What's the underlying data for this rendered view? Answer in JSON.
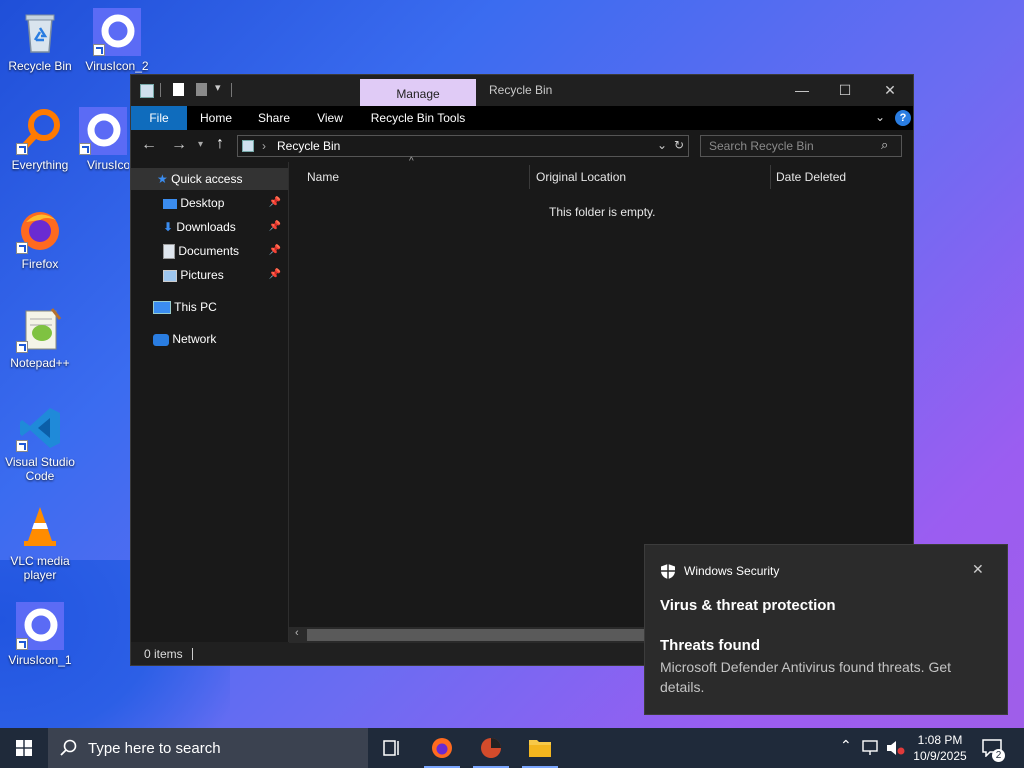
{
  "desktop": {
    "icons": [
      {
        "label": "Recycle Bin",
        "icon": "recycle-bin-icon"
      },
      {
        "label": "VirusIcon_2",
        "icon": "virus-ring-icon"
      },
      {
        "label": "Everything",
        "icon": "magnifier-icon"
      },
      {
        "label": "VirusIco",
        "icon": "virus-ring-icon"
      },
      {
        "label": "Firefox",
        "icon": "firefox-icon"
      },
      {
        "label": "Notepad++",
        "icon": "notepad-plus-plus-icon"
      },
      {
        "label": "Visual Studio Code",
        "icon": "vscode-icon"
      },
      {
        "label": "VLC media player",
        "icon": "vlc-cone-icon"
      },
      {
        "label": "VirusIcon_1",
        "icon": "virus-ring-icon"
      }
    ]
  },
  "explorer": {
    "titlebar": {
      "manage_tab": "Manage",
      "title": "Recycle Bin",
      "minimize": "—",
      "maximize": "☐",
      "close": "✕"
    },
    "ribbon": {
      "tabs": [
        "File",
        "Home",
        "Share",
        "View",
        "Recycle Bin Tools"
      ],
      "help": "?"
    },
    "address": {
      "path": "Recycle Bin",
      "search_placeholder": "Search Recycle Bin"
    },
    "nav": {
      "quick_access": "Quick access",
      "pinned": [
        "Desktop",
        "Downloads",
        "Documents",
        "Pictures"
      ],
      "this_pc": "This PC",
      "network": "Network"
    },
    "columns": [
      "Name",
      "Original Location",
      "Date Deleted"
    ],
    "empty_message": "This folder is empty.",
    "status": "0 items"
  },
  "toast": {
    "app": "Windows Security",
    "heading": "Virus & threat protection",
    "title": "Threats found",
    "body": "Microsoft Defender Antivirus found threats. Get details.",
    "close": "✕"
  },
  "taskbar": {
    "search_placeholder": "Type here to search",
    "time": "1:08 PM",
    "date": "10/9/2025",
    "notification_count": "2"
  },
  "colors": {
    "accent_blue": "#0f6cbd",
    "manage_tab": "#e0cbf6",
    "toast_bg": "#2b2b2b",
    "taskbar_bg": "#1f2a3a"
  }
}
